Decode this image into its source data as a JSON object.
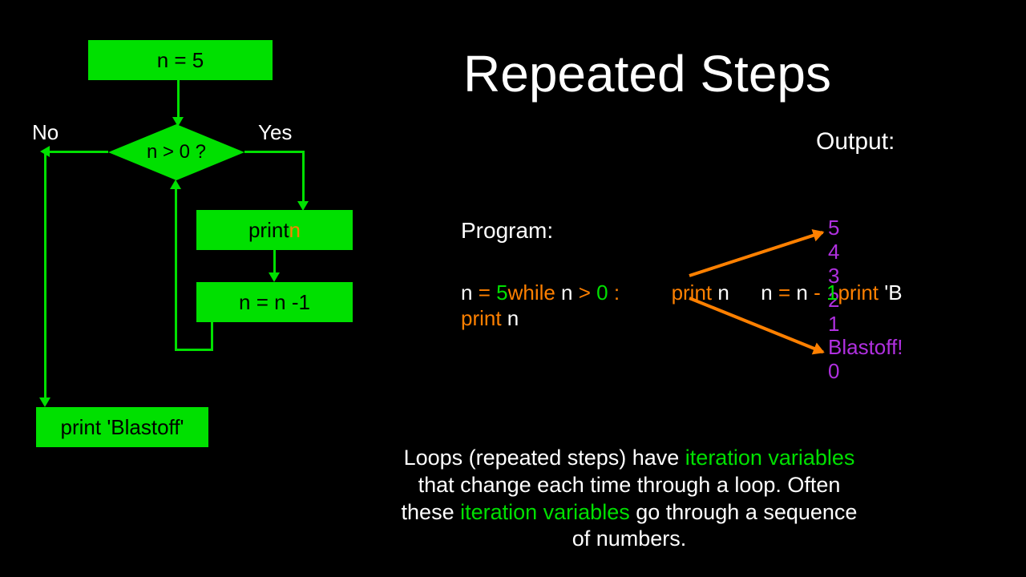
{
  "flowchart": {
    "box1": "n = 5",
    "decision": "n > 0 ?",
    "box2_prefix": "print ",
    "box2_var": "n",
    "box3": "n = n -1",
    "box4": "print 'Blastoff'",
    "no_label": "No",
    "yes_label": "Yes"
  },
  "title": "Repeated Steps",
  "output_label": "Output:",
  "program_label": "Program:",
  "code": {
    "seg1a": "n ",
    "seg1b": "= ",
    "seg1c": "5",
    "seg2a": "while",
    "seg2b": " n ",
    "seg2c": "> ",
    "seg2d": "0 ",
    "seg2e": ":",
    "seg3a": "print",
    "seg3b": " n",
    "seg4a": "n ",
    "seg4b": "= ",
    "seg4c": "n ",
    "seg4d": "- ",
    "seg4e": "1",
    "seg5a": "print",
    "seg5b": " 'B",
    "seg6a": "print",
    "seg6b": " n"
  },
  "output_values": [
    "5",
    "4",
    "3",
    "2",
    "1",
    "Blastoff!",
    "0"
  ],
  "explanation": {
    "l1a": "Loops (repeated steps) have ",
    "l1b": "iteration variables",
    "l2": "that change each time through a loop.  Often",
    "l3a": "these ",
    "l3b": "iteration variables",
    "l3c": " go through a sequence",
    "l4": "of numbers."
  }
}
